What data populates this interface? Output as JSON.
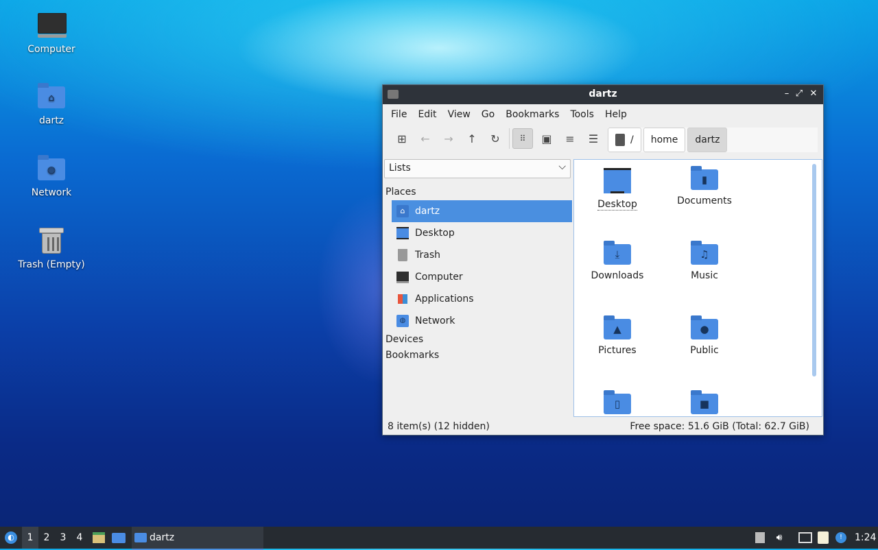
{
  "desktop": {
    "icons": [
      {
        "label": "Computer"
      },
      {
        "label": "dartz"
      },
      {
        "label": "Network"
      },
      {
        "label": "Trash (Empty)"
      }
    ]
  },
  "window": {
    "title": "dartz",
    "buttons": {
      "minimize": "–",
      "maximize": "⤢",
      "close": "✕"
    },
    "menu": [
      "File",
      "Edit",
      "View",
      "Go",
      "Bookmarks",
      "Tools",
      "Help"
    ],
    "path": {
      "root": "/",
      "segments": [
        "home",
        "dartz"
      ]
    },
    "sidebar": {
      "mode": "Lists",
      "sections": {
        "places": "Places",
        "devices": "Devices",
        "bookmarks": "Bookmarks"
      },
      "places": [
        "dartz",
        "Desktop",
        "Trash",
        "Computer",
        "Applications",
        "Network"
      ],
      "selected": "dartz"
    },
    "content": {
      "items": [
        "Desktop",
        "Documents",
        "Downloads",
        "Music",
        "Pictures",
        "Public",
        "",
        ""
      ]
    },
    "status": {
      "left": "8 item(s) (12 hidden)",
      "right": "Free space: 51.6 GiB (Total: 62.7 GiB)"
    }
  },
  "taskbar": {
    "workspaces": [
      "1",
      "2",
      "3",
      "4"
    ],
    "current_workspace": "1",
    "task": "dartz",
    "clock": "1:24"
  },
  "colors": {
    "accent": "#4a8fe0",
    "titlebar": "#2e333a",
    "folder": "#4a8ce3"
  }
}
